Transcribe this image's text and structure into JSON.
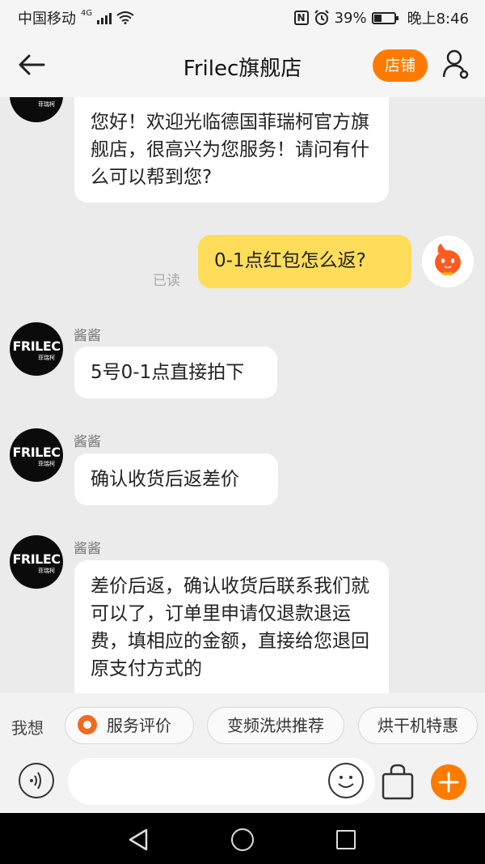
{
  "status_bar": {
    "carrier": "中国移动",
    "network": "4G",
    "battery": "39%",
    "time": "晚上8:46"
  },
  "header": {
    "title": "Frilec旗舰店",
    "shop_button": "店铺"
  },
  "shop_avatar": {
    "brand": "FRILEC",
    "brand_sub": "菲瑞柯"
  },
  "messages": [
    {
      "from": "shop",
      "text": "您好！欢迎光临德国菲瑞柯官方旗舰店，很高兴为您服务！请问有什么可以帮到您?"
    },
    {
      "from": "me",
      "text": "0-1点红包怎么返?",
      "status": "已读"
    },
    {
      "from": "shop",
      "sender": "酱酱",
      "text": "5号0-1点直接拍下"
    },
    {
      "from": "shop",
      "sender": "酱酱",
      "text": "确认收货后返差价"
    },
    {
      "from": "shop",
      "sender": "酱酱",
      "text": "差价后返，确认收货后联系我们就可以了，订单里申请仅退款退运费，填相应的金额，直接给您退回原支付方式的"
    }
  ],
  "quick_replies": {
    "label": "我想",
    "chips": [
      "服务评价",
      "变频洗烘推荐",
      "烘干机特惠"
    ]
  },
  "input_bar": {
    "value": "",
    "placeholder": ""
  },
  "colors": {
    "accent": "#ff7a00",
    "my_bubble": "#fedd5a",
    "chat_bg": "#ebebeb"
  },
  "icons": {
    "header_back": "back-arrow-icon",
    "header_user": "user-settings-icon",
    "voice": "voice-icon",
    "emoji": "emoji-icon",
    "bag": "shopping-bag-icon",
    "plus": "plus-icon"
  }
}
